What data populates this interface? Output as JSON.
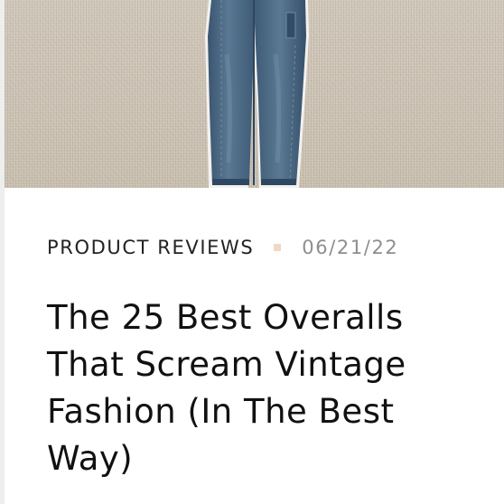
{
  "hero": {
    "image_subject": "blue-denim-overalls",
    "background": "#cbc2b4",
    "denim_color": "#4d6a86"
  },
  "article": {
    "category": "PRODUCT REVIEWS",
    "date": "06/21/22",
    "title": "The 25 Best Overalls That Scream Vintage Fashion (In The Best Way)"
  },
  "colors": {
    "separator": "#efd9c1",
    "date_text": "#8e8e8e",
    "title_text": "#111111"
  }
}
